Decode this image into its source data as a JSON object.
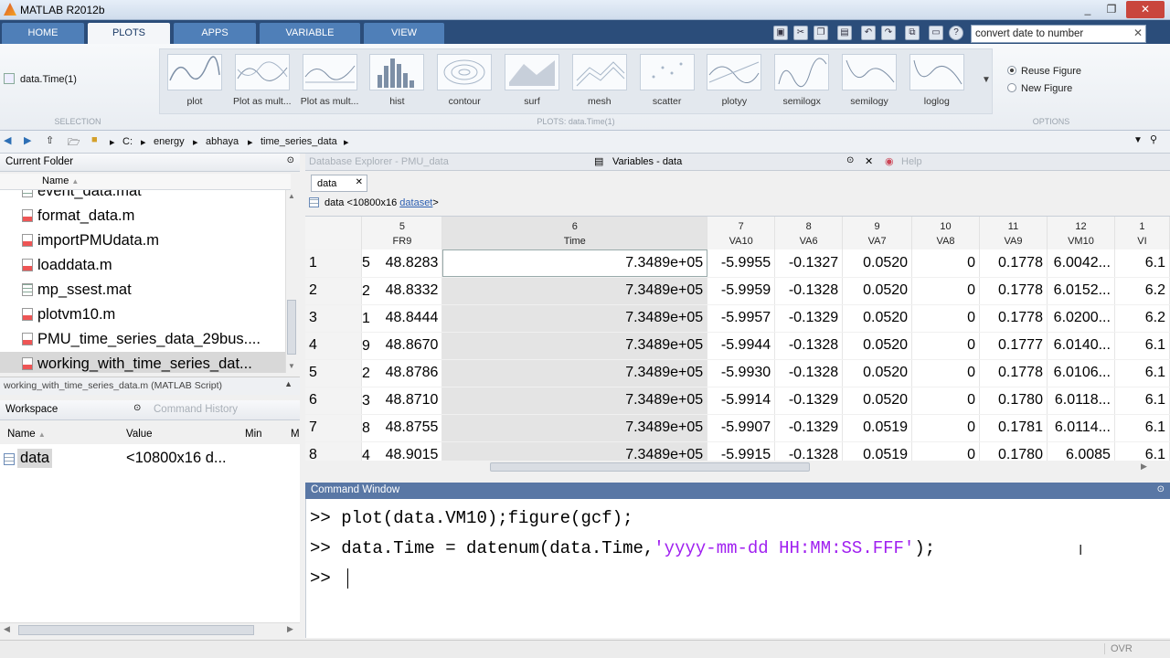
{
  "window": {
    "title": "MATLAB R2012b",
    "controls": [
      "_",
      "❐",
      "✕"
    ]
  },
  "ribbon_tabs": [
    "HOME",
    "PLOTS",
    "APPS",
    "VARIABLE",
    "VIEW"
  ],
  "search": {
    "value": "convert date to number"
  },
  "selection": {
    "variable": "data.Time(1)",
    "label": "SELECTION"
  },
  "plots_section": {
    "label": "PLOTS: data.Time(1)",
    "gallery": [
      "plot",
      "Plot as mult...",
      "Plot as mult...",
      "hist",
      "contour",
      "surf",
      "mesh",
      "scatter",
      "plotyy",
      "semilogx",
      "semilogy",
      "loglog"
    ]
  },
  "options": {
    "label": "OPTIONS",
    "reuse_figure": "Reuse Figure",
    "new_figure": "New Figure"
  },
  "path": {
    "drive": "C:",
    "parts": [
      "energy",
      "abhaya",
      "time_series_data"
    ]
  },
  "current_folder": {
    "title": "Current Folder",
    "name_col": "Name",
    "files": [
      {
        "name": "event_data.mat",
        "type": "mat"
      },
      {
        "name": "format_data.m",
        "type": "m"
      },
      {
        "name": "importPMUdata.m",
        "type": "m"
      },
      {
        "name": "loaddata.m",
        "type": "m"
      },
      {
        "name": "mp_ssest.mat",
        "type": "mat"
      },
      {
        "name": "plotvm10.m",
        "type": "m"
      },
      {
        "name": "PMU_time_series_data_29bus....",
        "type": "m"
      },
      {
        "name": "working_with_time_series_dat...",
        "type": "m",
        "selected": true
      }
    ],
    "status": "working_with_time_series_data.m (MATLAB Script)"
  },
  "workspace": {
    "title": "Workspace",
    "other_tab": "Command History",
    "cols": {
      "name": "Name",
      "value": "Value",
      "min": "Min",
      "max": "M"
    },
    "rows": [
      {
        "name": "data",
        "value": "<10800x16 d..."
      }
    ]
  },
  "doc_tabs": {
    "db_explorer": "Database Explorer - PMU_data",
    "variables": "Variables - data",
    "help": "Help"
  },
  "var_editor": {
    "tab": "data",
    "info_prefix": "data <10800x16",
    "info_link": "dataset",
    "info_suffix": ">",
    "columns": [
      {
        "num": "5",
        "name": "FR9"
      },
      {
        "num": "6",
        "name": "Time"
      },
      {
        "num": "7",
        "name": "VA10"
      },
      {
        "num": "8",
        "name": "VA6"
      },
      {
        "num": "9",
        "name": "VA7"
      },
      {
        "num": "10",
        "name": "VA8"
      },
      {
        "num": "11",
        "name": "VA9"
      },
      {
        "num": "12",
        "name": "VM10"
      },
      {
        "num": "1",
        "name": "VI"
      }
    ],
    "rows": [
      {
        "n": "1",
        "pre": "5",
        "cells": [
          "48.8283",
          "7.3489e+05",
          "-5.9955",
          "-0.1327",
          "0.0520",
          "0",
          "0.1778",
          "6.0042...",
          "6.1"
        ]
      },
      {
        "n": "2",
        "pre": "2",
        "cells": [
          "48.8332",
          "7.3489e+05",
          "-5.9959",
          "-0.1328",
          "0.0520",
          "0",
          "0.1778",
          "6.0152...",
          "6.2"
        ]
      },
      {
        "n": "3",
        "pre": "1",
        "cells": [
          "48.8444",
          "7.3489e+05",
          "-5.9957",
          "-0.1329",
          "0.0520",
          "0",
          "0.1778",
          "6.0200...",
          "6.2"
        ]
      },
      {
        "n": "4",
        "pre": "9",
        "cells": [
          "48.8670",
          "7.3489e+05",
          "-5.9944",
          "-0.1328",
          "0.0520",
          "0",
          "0.1777",
          "6.0140...",
          "6.1"
        ]
      },
      {
        "n": "5",
        "pre": "2",
        "cells": [
          "48.8786",
          "7.3489e+05",
          "-5.9930",
          "-0.1328",
          "0.0520",
          "0",
          "0.1778",
          "6.0106...",
          "6.1"
        ]
      },
      {
        "n": "6",
        "pre": "3",
        "cells": [
          "48.8710",
          "7.3489e+05",
          "-5.9914",
          "-0.1329",
          "0.0520",
          "0",
          "0.1780",
          "6.0118...",
          "6.1"
        ]
      },
      {
        "n": "7",
        "pre": "8",
        "cells": [
          "48.8755",
          "7.3489e+05",
          "-5.9907",
          "-0.1329",
          "0.0519",
          "0",
          "0.1781",
          "6.0114...",
          "6.1"
        ]
      },
      {
        "n": "8",
        "pre": "4",
        "cells": [
          "48.9015",
          "7.3489e+05",
          "-5.9915",
          "-0.1328",
          "0.0519",
          "0",
          "0.1780",
          "6.0085",
          "6.1"
        ]
      }
    ]
  },
  "command_window": {
    "title": "Command Window",
    "prompt": ">>",
    "lines": [
      {
        "code": "plot(data.VM10);figure(gcf);",
        "pre": "",
        "str": "",
        "post": ""
      },
      {
        "code": "",
        "pre": "data.Time = datenum(data.Time,",
        "str": "'yyyy-mm-dd HH:MM:SS.FFF'",
        "post": ");"
      }
    ]
  },
  "status_bar": {
    "ovr": "OVR"
  }
}
